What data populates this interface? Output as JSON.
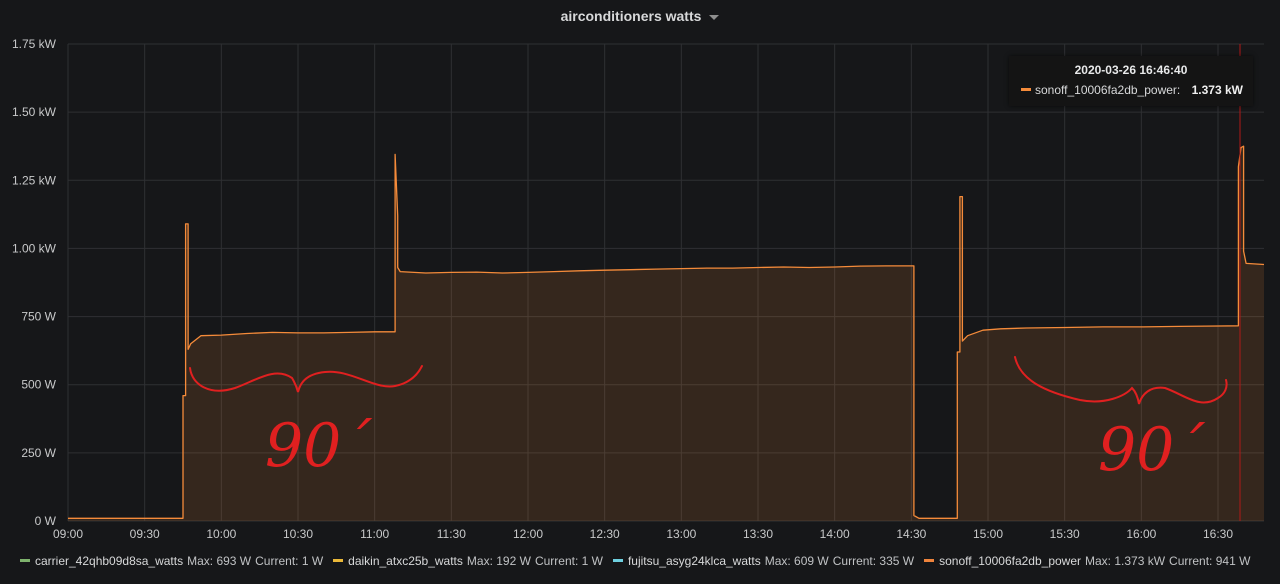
{
  "panel": {
    "title": "airconditioners watts"
  },
  "colors": {
    "sonoff": "#f58b3a",
    "annotation": "#e02020",
    "cursor": "#b01818"
  },
  "chart_data": {
    "type": "area",
    "title": "airconditioners watts",
    "xlabel": "",
    "ylabel": "",
    "xlim": [
      "09:00",
      "16:48"
    ],
    "ylim": [
      0,
      1750
    ],
    "y_ticks": [
      "0 W",
      "250 W",
      "500 W",
      "750 W",
      "1.00 kW",
      "1.25 kW",
      "1.50 kW",
      "1.75 kW"
    ],
    "x_ticks": [
      "09:00",
      "09:30",
      "10:00",
      "10:30",
      "11:00",
      "11:30",
      "12:00",
      "12:30",
      "13:00",
      "13:30",
      "14:00",
      "14:30",
      "15:00",
      "15:30",
      "16:00",
      "16:30"
    ],
    "grid": true,
    "legend_position": "bottom",
    "series": [
      {
        "name": "sonoff_10006fa2db_power",
        "color": "#f58b3a",
        "points": [
          [
            "09:00",
            10
          ],
          [
            "09:45",
            10
          ],
          [
            "09:45",
            460
          ],
          [
            "09:46",
            460
          ],
          [
            "09:46",
            1090
          ],
          [
            "09:47",
            1090
          ],
          [
            "09:47",
            630
          ],
          [
            "09:48",
            650
          ],
          [
            "09:52",
            680
          ],
          [
            "10:00",
            682
          ],
          [
            "10:10",
            688
          ],
          [
            "10:20",
            692
          ],
          [
            "10:30",
            690
          ],
          [
            "10:40",
            690
          ],
          [
            "10:50",
            692
          ],
          [
            "11:00",
            694
          ],
          [
            "11:08",
            694
          ],
          [
            "11:08",
            1345
          ],
          [
            "11:09",
            1120
          ],
          [
            "11:09",
            930
          ],
          [
            "11:10",
            915
          ],
          [
            "11:20",
            910
          ],
          [
            "11:30",
            912
          ],
          [
            "11:40",
            913
          ],
          [
            "11:50",
            910
          ],
          [
            "12:00",
            912
          ],
          [
            "12:10",
            915
          ],
          [
            "12:20",
            918
          ],
          [
            "12:30",
            920
          ],
          [
            "12:40",
            922
          ],
          [
            "12:50",
            924
          ],
          [
            "13:00",
            926
          ],
          [
            "13:10",
            928
          ],
          [
            "13:20",
            928
          ],
          [
            "13:30",
            930
          ],
          [
            "13:40",
            932
          ],
          [
            "13:50",
            930
          ],
          [
            "14:00",
            932
          ],
          [
            "14:10",
            935
          ],
          [
            "14:20",
            936
          ],
          [
            "14:31",
            936
          ],
          [
            "14:31",
            20
          ],
          [
            "14:33",
            10
          ],
          [
            "14:48",
            10
          ],
          [
            "14:48",
            620
          ],
          [
            "14:49",
            620
          ],
          [
            "14:49",
            1190
          ],
          [
            "14:50",
            1190
          ],
          [
            "14:50",
            660
          ],
          [
            "14:52",
            680
          ],
          [
            "14:58",
            700
          ],
          [
            "15:05",
            705
          ],
          [
            "15:15",
            708
          ],
          [
            "15:30",
            710
          ],
          [
            "15:45",
            712
          ],
          [
            "16:00",
            712
          ],
          [
            "16:15",
            714
          ],
          [
            "16:25",
            715
          ],
          [
            "16:38",
            716
          ],
          [
            "16:38",
            1300
          ],
          [
            "16:39",
            1370
          ],
          [
            "16:40",
            1375
          ],
          [
            "16:40",
            990
          ],
          [
            "16:41",
            945
          ],
          [
            "16:48",
            941
          ]
        ]
      }
    ],
    "legend": [
      {
        "name": "carrier_42qhb09d8sa_watts",
        "color": "#7eb26d",
        "max": "Max: 693 W",
        "current": "Current: 1 W"
      },
      {
        "name": "daikin_atxc25b_watts",
        "color": "#eab839",
        "max": "Max: 192 W",
        "current": "Current: 1 W"
      },
      {
        "name": "fujitsu_asyg24klca_watts",
        "color": "#6ed0e0",
        "max": "Max: 609 W",
        "current": "Current: 335 W"
      },
      {
        "name": "sonoff_10006fa2db_power",
        "color": "#ef843c",
        "max": "Max: 1.373 kW",
        "current": "Current: 941 W"
      }
    ],
    "tooltip": {
      "time": "2020-03-26 16:46:40",
      "series": "sonoff_10006fa2db_power:",
      "value": "1.373 kW"
    },
    "annotations": [
      {
        "type": "brace",
        "text": "90´"
      },
      {
        "type": "brace",
        "text": "90´"
      }
    ]
  }
}
